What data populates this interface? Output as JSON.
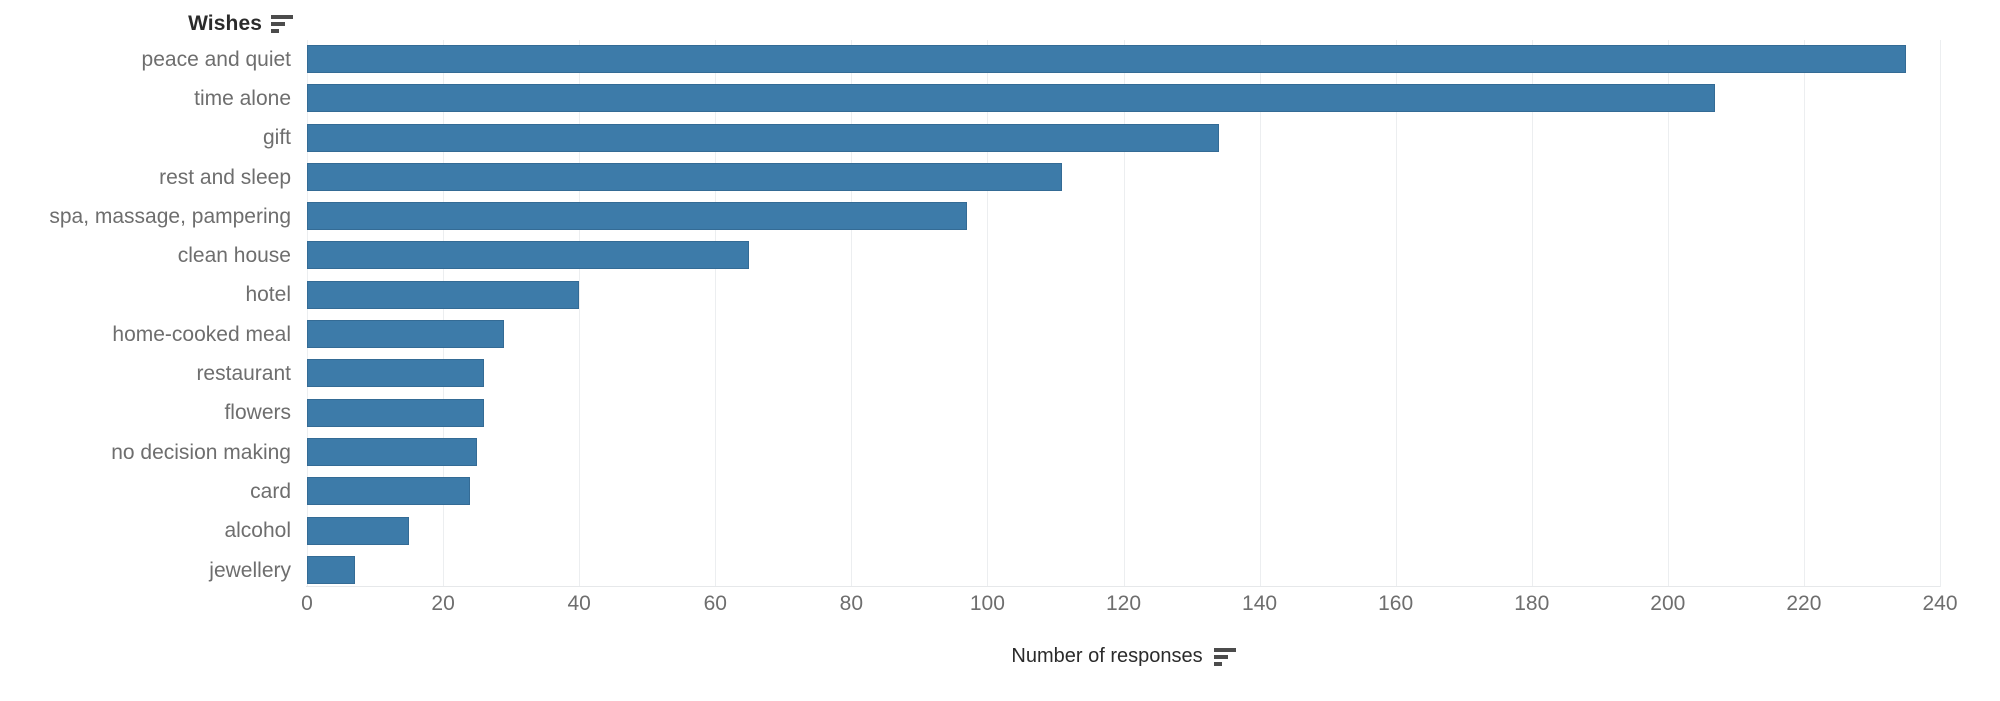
{
  "chart_data": {
    "type": "bar",
    "orientation": "horizontal",
    "title": "",
    "xlabel": "Number of responses",
    "ylabel": "Wishes",
    "xlim": [
      0,
      240
    ],
    "xticks": [
      0,
      20,
      40,
      60,
      80,
      100,
      120,
      140,
      160,
      180,
      200,
      220,
      240
    ],
    "grid": "vertical",
    "legend": "none",
    "bar_color": "#3d7ba9",
    "categories": [
      "peace and quiet",
      "time alone",
      "gift",
      "rest and sleep",
      "spa, massage, pampering",
      "clean house",
      "hotel",
      "home-cooked meal",
      "restaurant",
      "flowers",
      "no decision making",
      "card",
      "alcohol",
      "jewellery"
    ],
    "values": [
      235,
      207,
      134,
      111,
      97,
      65,
      40,
      29,
      26,
      26,
      25,
      24,
      15,
      7
    ]
  },
  "axes": {
    "category_axis": {
      "title": "Wishes",
      "sort_icon": "sort-descending-icon"
    },
    "value_axis": {
      "title": "Number of responses",
      "sort_icon": "sort-descending-icon"
    }
  },
  "colors": {
    "bar_fill": "#3d7ba9",
    "bar_stroke": "#346b95",
    "gridline": "#eceef0",
    "tick_text": "#6e6e6e",
    "title_text": "#2b2b2b",
    "background": "#ffffff"
  }
}
